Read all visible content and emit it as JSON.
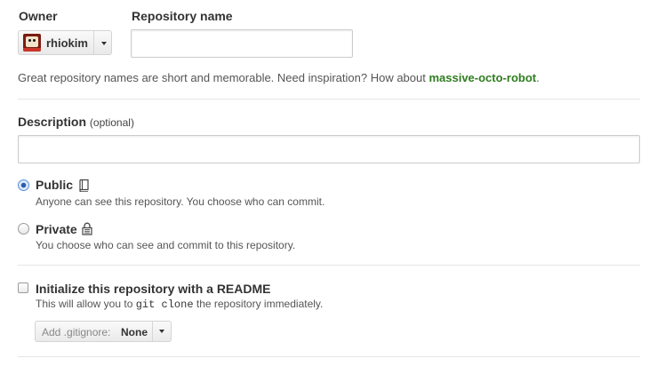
{
  "owner": {
    "label": "Owner",
    "selected": "rhiokim",
    "avatar_icon": "user-avatar-icon"
  },
  "repository": {
    "label": "Repository name",
    "value": "",
    "placeholder": ""
  },
  "hint": {
    "text": "Great repository names are short and memorable. Need inspiration? How about ",
    "suggestion": "massive-octo-robot",
    "suffix": "."
  },
  "description": {
    "label": "Description",
    "optional": "(optional)",
    "value": ""
  },
  "visibility": {
    "public": {
      "title": "Public",
      "desc": "Anyone can see this repository. You choose who can commit.",
      "checked": true,
      "icon": "book-icon"
    },
    "private": {
      "title": "Private",
      "desc": "You choose who can see and commit to this repository.",
      "checked": false,
      "icon": "lock-icon"
    }
  },
  "init": {
    "title": "Initialize this repository with a README",
    "desc_before": "This will allow you to ",
    "desc_code": "git clone",
    "desc_after": " the repository immediately.",
    "checked": false
  },
  "gitignore": {
    "prefix": "Add .gitignore:",
    "value": "None"
  },
  "colors": {
    "suggestion": "#2e7d1f",
    "divider": "#e5e5e5",
    "radio_selected": "#2a5ea8"
  }
}
